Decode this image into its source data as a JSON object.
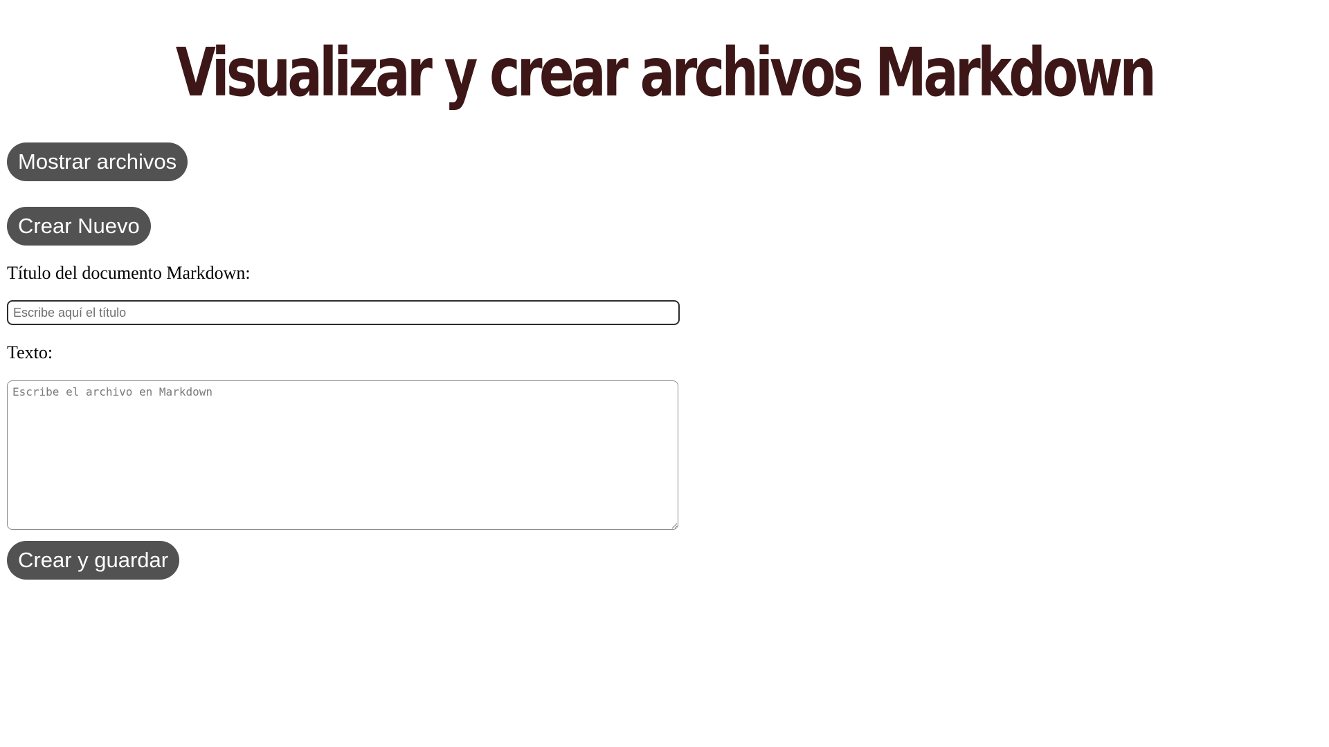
{
  "header": {
    "title": "Visualizar y crear archivos Markdown",
    "title_color": "#3d1717"
  },
  "buttons": {
    "color": "#525252",
    "show_files_label": "Mostrar archivos",
    "create_new_label": "Crear Nuevo",
    "create_save_label": "Crear y guardar"
  },
  "form": {
    "title_label": "Título del documento Markdown:",
    "title_value": "",
    "title_placeholder": "Escribe aquí el título",
    "text_label": "Texto:",
    "text_value": "",
    "text_placeholder": "Escribe el archivo en Markdown"
  }
}
